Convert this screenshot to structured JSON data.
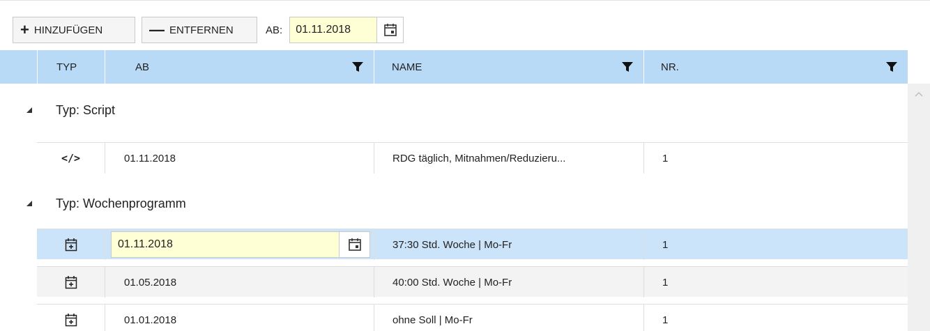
{
  "toolbar": {
    "add_label": "HINZUFÜGEN",
    "add_symbol": "+",
    "remove_label": "ENTFERNEN",
    "remove_symbol": "—",
    "from_label": "AB:",
    "from_value": "01.11.2018"
  },
  "columns": {
    "typ": "TYP",
    "ab": "AB",
    "name": "NAME",
    "nr": "NR."
  },
  "groups": [
    {
      "label": "Typ: Script",
      "rows": [
        {
          "icon": "code-icon",
          "icon_text": "</>",
          "ab": "01.11.2018",
          "name": "RDG täglich, Mitnahmen/Reduzieru...",
          "nr": "1"
        }
      ]
    },
    {
      "label": "Typ: Wochenprogramm",
      "rows": [
        {
          "icon": "calendar-plus-icon",
          "ab": "01.11.2018",
          "name": "37:30 Std. Woche | Mo-Fr",
          "nr": "1",
          "selected": true
        },
        {
          "icon": "calendar-plus-icon",
          "ab": "01.05.2018",
          "name": "40:00 Std. Woche | Mo-Fr",
          "nr": "1"
        },
        {
          "icon": "calendar-plus-icon",
          "ab": "01.01.2018",
          "name": "ohne Soll | Mo-Fr",
          "nr": "1"
        }
      ]
    }
  ],
  "colors": {
    "header_bg": "#b8daf6",
    "selected_row_bg": "#cce4fa",
    "edit_field_bg": "#ffffd6"
  }
}
